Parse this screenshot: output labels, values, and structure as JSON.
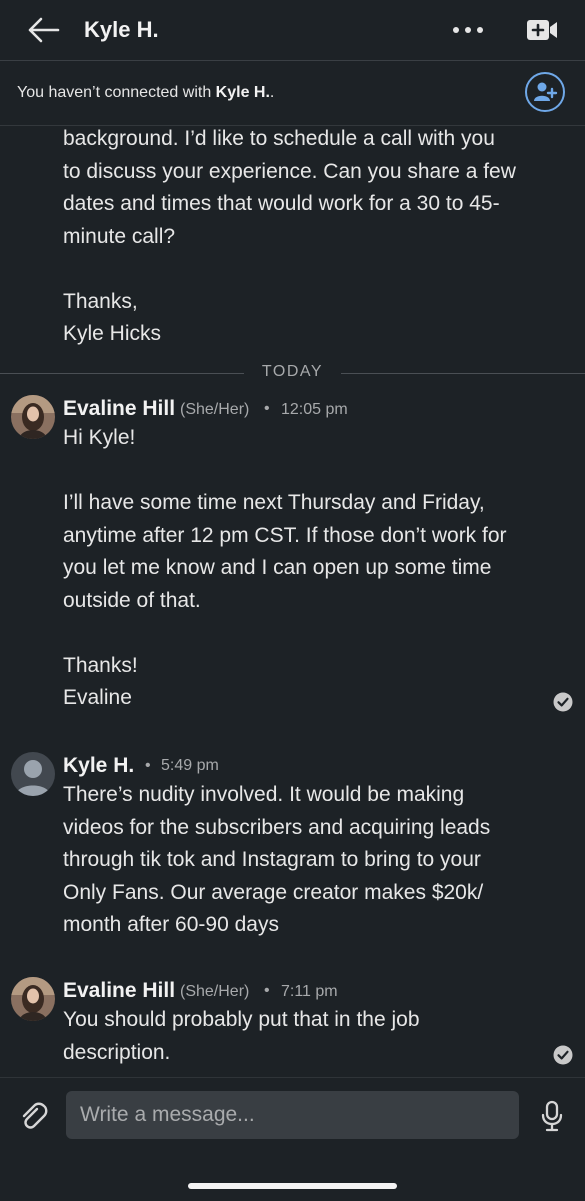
{
  "header": {
    "title": "Kyle H."
  },
  "banner": {
    "prefix": "You haven’t connected with ",
    "name": "Kyle H.",
    "suffix": "."
  },
  "prior_message": {
    "text": "background. I’d like to schedule a call with you\nto discuss your experience. Can you share a few\ndates and times that would work for a 30 to 45-\nminute call?\n\nThanks,\nKyle Hicks"
  },
  "divider_label": "TODAY",
  "messages": [
    {
      "sender": "Evaline Hill",
      "pronouns": "(She/Her)",
      "separator": "•",
      "time": "12:05 pm",
      "text": "Hi Kyle!\n\nI’ll have some time next Thursday and Friday,\nanytime after 12 pm CST. If those don’t work for\nyou let me know and I can open up some time\noutside of that.\n\nThanks!\nEvaline"
    },
    {
      "sender": "Kyle H.",
      "separator": "•",
      "time": "5:49 pm",
      "text": "There’s nudity involved. It would be making\nvideos for the subscribers and acquiring leads\nthrough tik tok and Instagram to bring to your\nOnly Fans. Our average creator makes $20k/\nmonth after 60-90 days"
    },
    {
      "sender": "Evaline Hill",
      "pronouns": "(She/Her)",
      "separator": "•",
      "time": "7:11 pm",
      "text": "You should probably put that in the job\ndescription."
    }
  ],
  "composer": {
    "placeholder": "Write a message..."
  },
  "colors": {
    "background": "#1d2226",
    "accent": "#6fa8e8",
    "input": "#393e43"
  },
  "icons": [
    "back-arrow-icon",
    "more-icon",
    "video-call-icon",
    "add-connection-icon",
    "read-receipt-icon",
    "paperclip-icon",
    "microphone-icon"
  ]
}
